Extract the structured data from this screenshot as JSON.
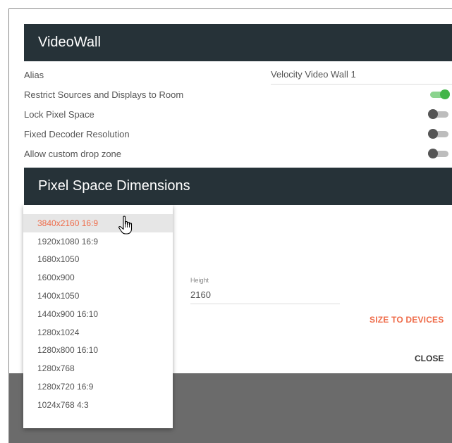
{
  "videowall": {
    "title": "VideoWall",
    "alias": {
      "label": "Alias",
      "value": "Velocity Video Wall 1"
    },
    "toggles": [
      {
        "label": "Restrict Sources and Displays to Room",
        "on": true
      },
      {
        "label": "Lock Pixel Space",
        "on": false
      },
      {
        "label": "Fixed Decoder Resolution",
        "on": false
      },
      {
        "label": "Allow custom drop zone",
        "on": false
      }
    ]
  },
  "pixel_space": {
    "title": "Pixel Space Dimensions",
    "height_label": "Height",
    "height_value": "2160",
    "size_to_devices": "SIZE TO DEVICES"
  },
  "resolution_dropdown": {
    "selected_index": 0,
    "options": [
      "3840x2160 16:9",
      "1920x1080 16:9",
      "1680x1050",
      "1600x900",
      "1400x1050",
      "1440x900 16:10",
      "1280x1024",
      "1280x800 16:10",
      "1280x768",
      "1280x720 16:9",
      "1024x768 4:3"
    ]
  },
  "footer": {
    "close_label": "CLOSE"
  },
  "colors": {
    "header_bg": "#263238",
    "accent": "#ef6c4a",
    "toggle_on": "#43b549",
    "toggle_off": "#555555",
    "overlay": "#6b6b6b"
  }
}
